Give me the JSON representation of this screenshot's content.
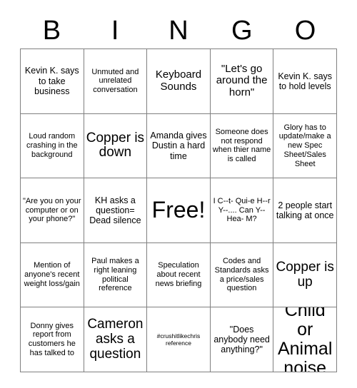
{
  "card": {
    "title": "BINGO",
    "header_letters": [
      "B",
      "I",
      "N",
      "G",
      "O"
    ],
    "columns": 5,
    "rows": 5,
    "grid_color": "#808080",
    "text_color": "#000000",
    "background_color": "#ffffff",
    "cells": [
      {
        "row": 1,
        "col": 1,
        "text": "Kevin K. says to take business",
        "size": "md",
        "free": false
      },
      {
        "row": 1,
        "col": 2,
        "text": "Unmuted and unrelated conversation",
        "size": "sm",
        "free": false
      },
      {
        "row": 1,
        "col": 3,
        "text": "Keyboard Sounds",
        "size": "lg",
        "free": false
      },
      {
        "row": 1,
        "col": 4,
        "text": "\"Let's go around the horn\"",
        "size": "lg",
        "free": false
      },
      {
        "row": 1,
        "col": 5,
        "text": "Kevin K. says to hold levels",
        "size": "md",
        "free": false
      },
      {
        "row": 2,
        "col": 1,
        "text": "Loud random crashing in the background",
        "size": "sm",
        "free": false
      },
      {
        "row": 2,
        "col": 2,
        "text": "Copper is down",
        "size": "xl",
        "free": false
      },
      {
        "row": 2,
        "col": 3,
        "text": "Amanda gives Dustin a hard time",
        "size": "md",
        "free": false
      },
      {
        "row": 2,
        "col": 4,
        "text": "Someone does not respond when thier name is called",
        "size": "sm",
        "free": false
      },
      {
        "row": 2,
        "col": 5,
        "text": "Glory has to update/make a new Spec Sheet/Sales Sheet",
        "size": "sm",
        "free": false
      },
      {
        "row": 3,
        "col": 1,
        "text": "\"Are you on your computer or on your phone?\"",
        "size": "sm",
        "free": false
      },
      {
        "row": 3,
        "col": 2,
        "text": "KH asks a question= Dead silence",
        "size": "md",
        "free": false
      },
      {
        "row": 3,
        "col": 3,
        "text": "Free!",
        "size": "free",
        "free": true
      },
      {
        "row": 3,
        "col": 4,
        "text": "I C--t- Qui-e H--r Y--.... Can Y-- Hea- M?",
        "size": "sm",
        "free": false
      },
      {
        "row": 3,
        "col": 5,
        "text": "2 people start talking at once",
        "size": "md",
        "free": false
      },
      {
        "row": 4,
        "col": 1,
        "text": "Mention of anyone's recent weight loss/gain",
        "size": "sm",
        "free": false
      },
      {
        "row": 4,
        "col": 2,
        "text": "Paul makes a right leaning political reference",
        "size": "sm",
        "free": false
      },
      {
        "row": 4,
        "col": 3,
        "text": "Speculation about recent news briefing",
        "size": "sm",
        "free": false
      },
      {
        "row": 4,
        "col": 4,
        "text": "Codes and Standards asks a price/sales question",
        "size": "sm",
        "free": false
      },
      {
        "row": 4,
        "col": 5,
        "text": "Copper is up",
        "size": "xl",
        "free": false
      },
      {
        "row": 5,
        "col": 1,
        "text": "Donny gives report from customers he has talked to",
        "size": "sm",
        "free": false
      },
      {
        "row": 5,
        "col": 2,
        "text": "Cameron asks a question",
        "size": "xl",
        "free": false
      },
      {
        "row": 5,
        "col": 3,
        "text": "#crushitlikechris reference",
        "size": "xs",
        "free": false
      },
      {
        "row": 5,
        "col": 4,
        "text": "\"Does anybody need anything?\"",
        "size": "md",
        "free": false
      },
      {
        "row": 5,
        "col": 5,
        "text": "Child or Animal noise",
        "size": "xxl",
        "free": false
      }
    ]
  }
}
